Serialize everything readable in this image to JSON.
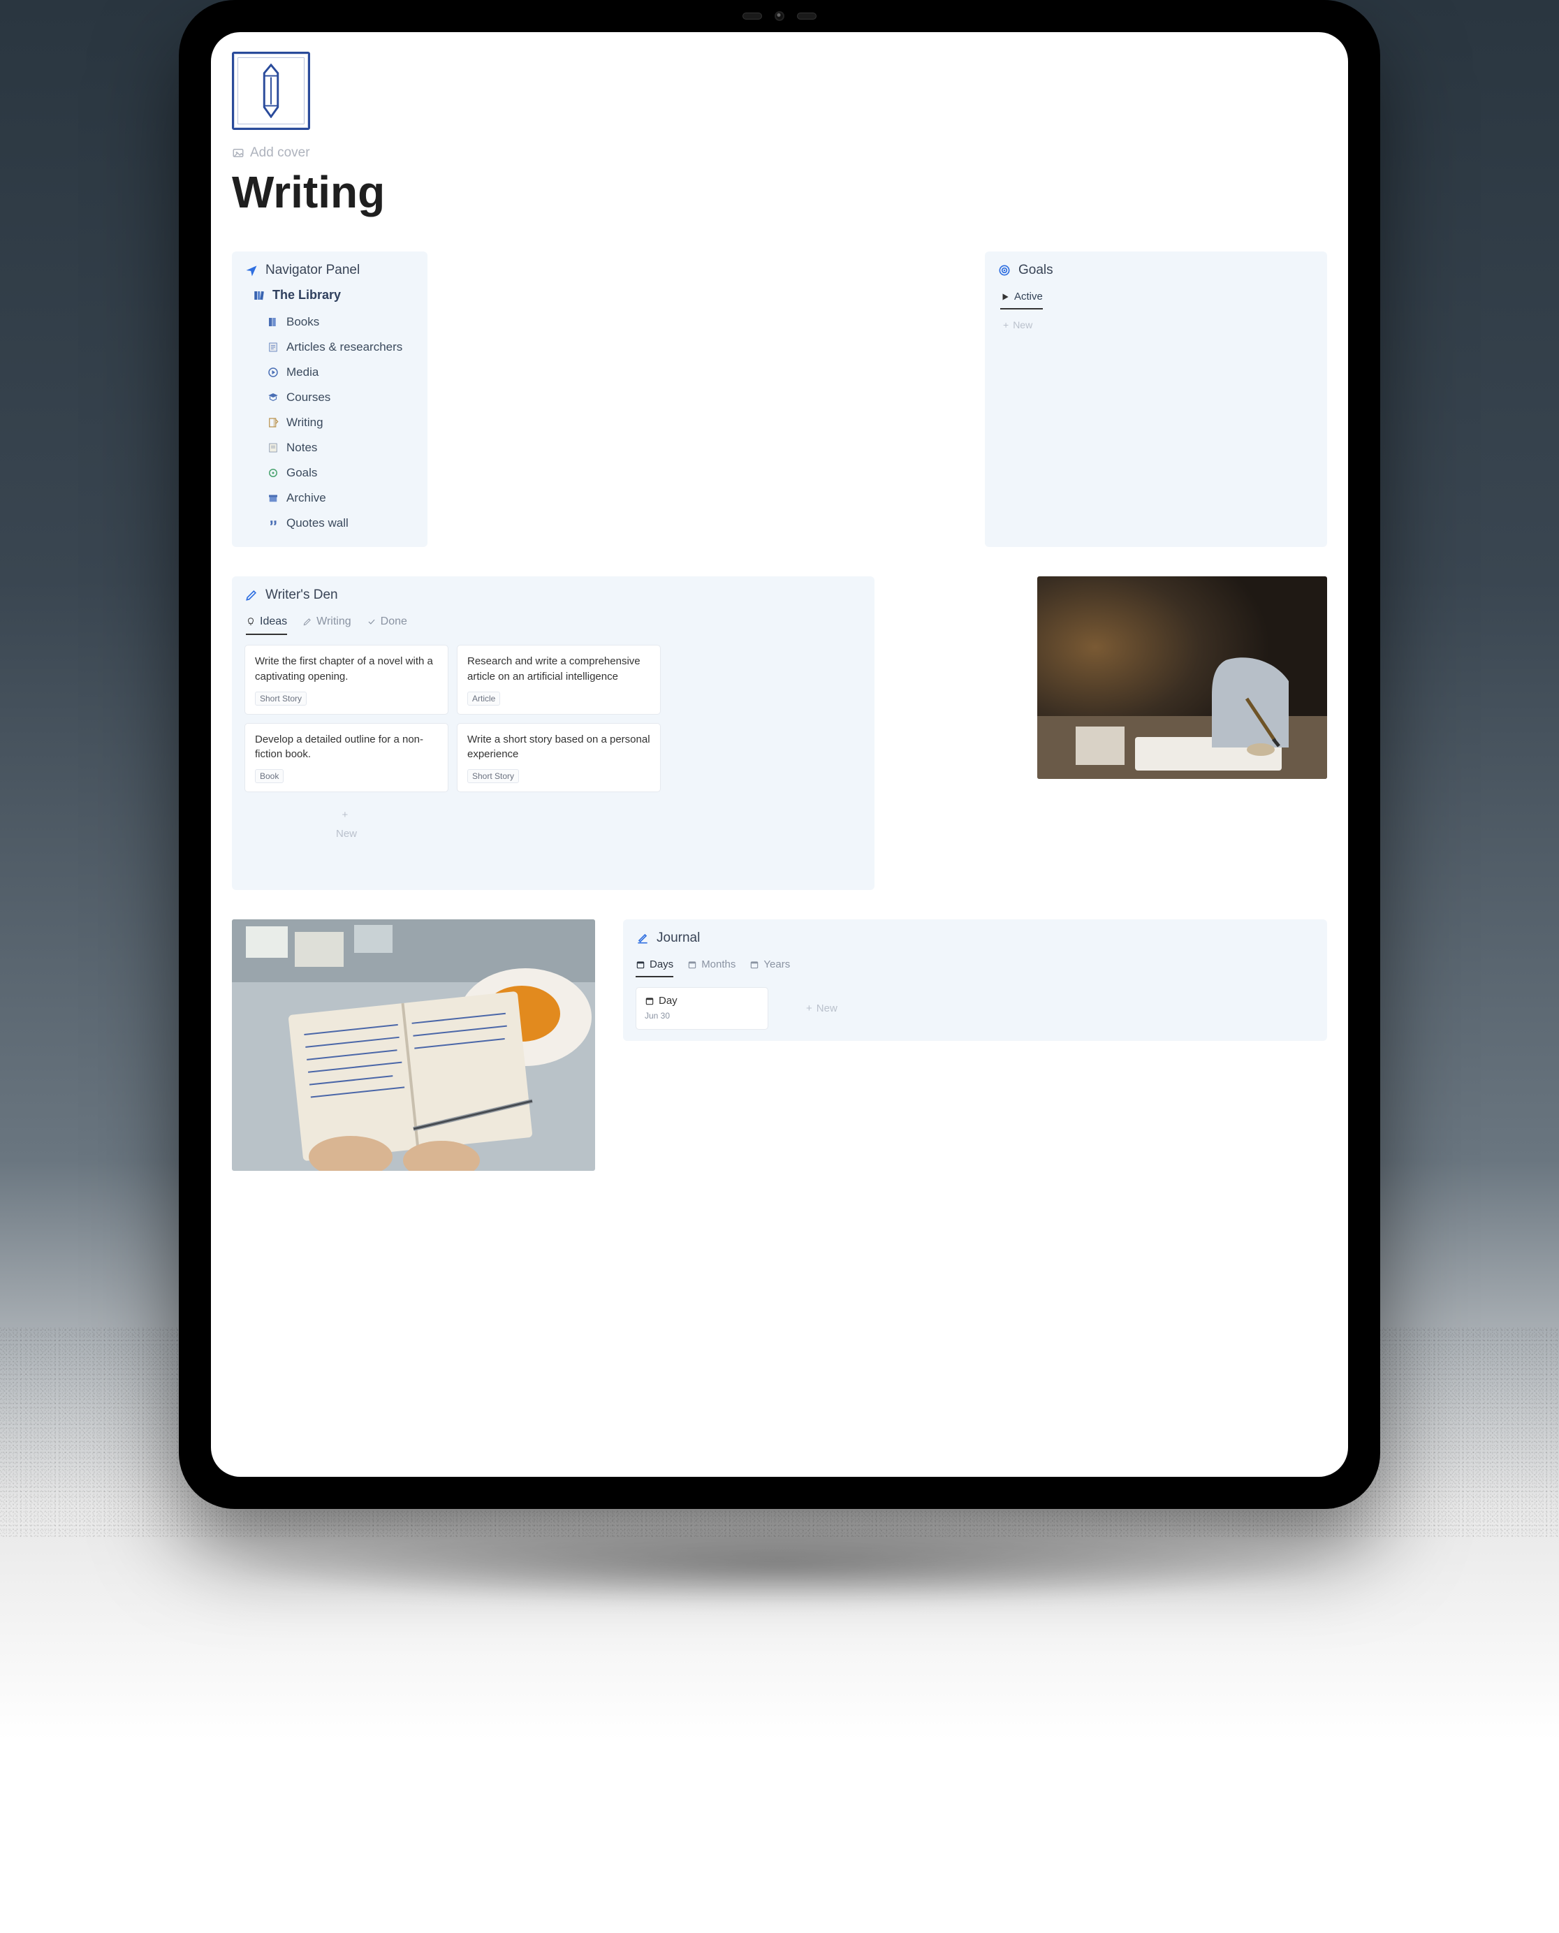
{
  "page": {
    "add_cover": "Add cover",
    "title": "Writing"
  },
  "navigator": {
    "title": "Navigator Panel",
    "library_label": "The Library",
    "items": [
      {
        "icon": "books-icon",
        "label": "Books"
      },
      {
        "icon": "articles-icon",
        "label": "Articles & researchers"
      },
      {
        "icon": "media-icon",
        "label": "Media"
      },
      {
        "icon": "courses-icon",
        "label": "Courses"
      },
      {
        "icon": "writing-icon",
        "label": "Writing"
      },
      {
        "icon": "notes-icon",
        "label": "Notes"
      },
      {
        "icon": "goals-icon",
        "label": "Goals"
      },
      {
        "icon": "archive-icon",
        "label": "Archive"
      },
      {
        "icon": "quotes-icon",
        "label": "Quotes wall"
      }
    ]
  },
  "goals": {
    "title": "Goals",
    "tabs": [
      {
        "label": "Active",
        "active": true
      }
    ],
    "new_label": "New"
  },
  "writers_den": {
    "title": "Writer's Den",
    "tabs": [
      {
        "key": "ideas",
        "label": "Ideas",
        "active": true
      },
      {
        "key": "writing",
        "label": "Writing",
        "active": false
      },
      {
        "key": "done",
        "label": "Done",
        "active": false
      }
    ],
    "new_label": "New",
    "cards": [
      {
        "title": "Write the first chapter of a novel with a captivating opening.",
        "tag": "Short Story"
      },
      {
        "title": "Research and write a comprehensive article on an artificial intelligence",
        "tag": "Article"
      },
      {
        "title": "Develop a detailed outline for a non-fiction book.",
        "tag": "Book"
      },
      {
        "title": "Write a short story based on a personal experience",
        "tag": "Short Story"
      }
    ]
  },
  "journal": {
    "title": "Journal",
    "tabs": [
      {
        "label": "Days",
        "active": true
      },
      {
        "label": "Months",
        "active": false
      },
      {
        "label": "Years",
        "active": false
      }
    ],
    "entry": {
      "label": "Day",
      "date": "Jun 30"
    },
    "new_label": "New"
  }
}
